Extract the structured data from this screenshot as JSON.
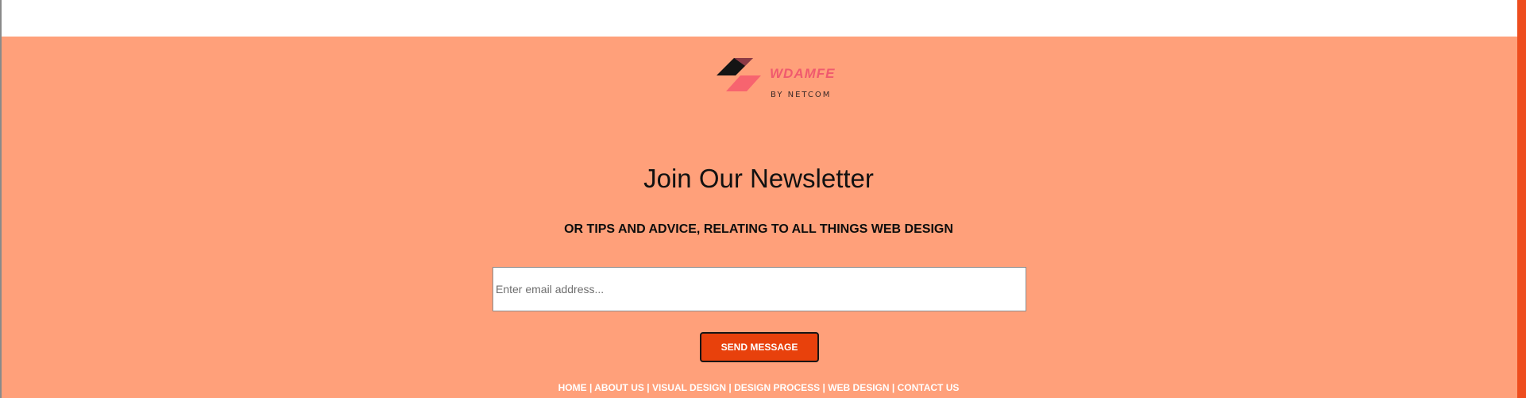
{
  "logo": {
    "title": "WDAMFE",
    "subtitle": "BY NETCOM"
  },
  "newsletter": {
    "heading": "Join Our Newsletter",
    "subheading": "OR TIPS AND ADVICE, RELATING TO ALL THINGS WEB DESIGN",
    "email_placeholder": "Enter email address...",
    "email_value": "",
    "send_label": "SEND MESSAGE"
  },
  "footer_nav": {
    "separator": "|",
    "items": [
      {
        "label": "HOME"
      },
      {
        "label": "ABOUT US"
      },
      {
        "label": "VISUAL DESIGN"
      },
      {
        "label": "DESIGN PROCESS"
      },
      {
        "label": "WEB DESIGN"
      },
      {
        "label": "CONTACT US"
      }
    ]
  },
  "colors": {
    "footer_background": "#ffa07a",
    "accent": "#e8410c",
    "logo_pink": "#f05a6e",
    "scrollbar": "#ee4d1e"
  }
}
